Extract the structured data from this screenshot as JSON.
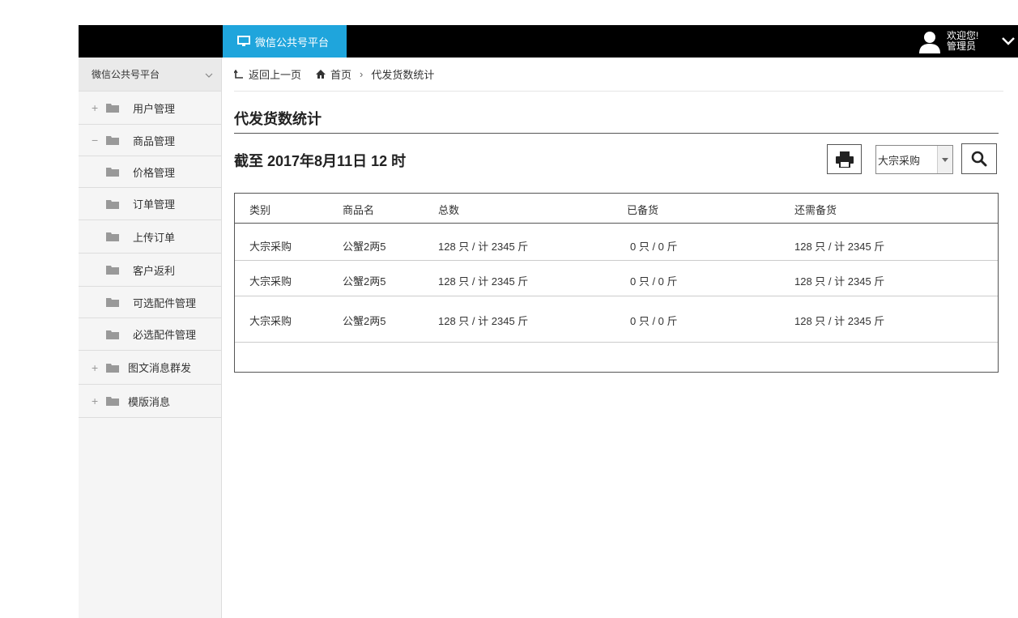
{
  "header": {
    "platform_tab": "微信公共号平台",
    "user_greeting": "欢迎您!",
    "user_role": "管理员"
  },
  "sidebar": {
    "title": "微信公共号平台",
    "items": [
      {
        "label": "用户管理",
        "expander": "+"
      },
      {
        "label": "商品管理",
        "expander": "−"
      },
      {
        "label": "价格管理"
      },
      {
        "label": "订单管理"
      },
      {
        "label": "上传订单"
      },
      {
        "label": "客户返利"
      },
      {
        "label": "可选配件管理"
      },
      {
        "label": "必选配件管理"
      },
      {
        "label": "图文消息群发",
        "expander": "+"
      },
      {
        "label": "模版消息",
        "expander": "+"
      }
    ]
  },
  "breadcrumb": {
    "back": "返回上一页",
    "home": "首页",
    "sep": "›",
    "current": "代发货数统计"
  },
  "page": {
    "title": "代发货数统计",
    "date_line": "截至 2017年8月11日 12 时"
  },
  "filter": {
    "select_value": "大宗采购"
  },
  "table": {
    "columns": [
      "类别",
      "商品名",
      "总数",
      "已备货",
      "还需备货"
    ],
    "rows": [
      [
        "大宗采购",
        "公蟹2两5",
        "128  只  / 计  2345  斤",
        "0 只  /  0 斤",
        "128  只  / 计  2345  斤"
      ],
      [
        "大宗采购",
        "公蟹2两5",
        "128  只  / 计  2345  斤",
        "0 只  /  0 斤",
        "128  只  / 计  2345  斤"
      ],
      [
        "大宗采购",
        "公蟹2两5",
        "128  只  / 计  2345  斤",
        "0 只  /  0 斤",
        "128  只  / 计  2345  斤"
      ]
    ]
  },
  "icons": {
    "monitor": "monitor-icon",
    "user": "user-avatar-icon",
    "print": "print-icon",
    "search": "search-icon",
    "home": "home-icon",
    "back": "back-arrow-icon",
    "folder": "folder-icon"
  },
  "colors": {
    "accent": "#1fa5dc",
    "topbar": "#000000",
    "sidebar_bg": "#f5f5f5"
  }
}
